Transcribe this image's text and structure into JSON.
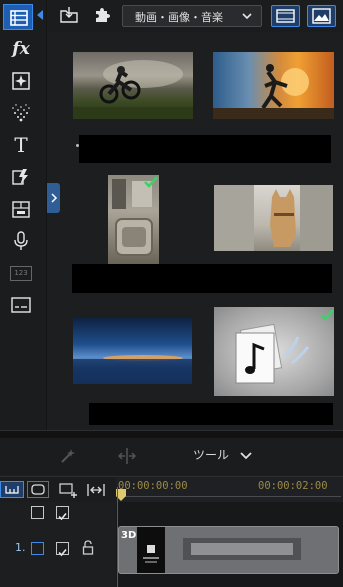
{
  "toolbar": {
    "media_filter": "動画・画像・音楽",
    "import_icon": "import-folder-icon",
    "plugin_icon": "plugin-puzzle-icon"
  },
  "rail": {
    "items": [
      {
        "name": "media-room",
        "icon": "film-strip-icon",
        "active": true
      },
      {
        "name": "effect-room",
        "icon": "fx-icon",
        "label": "fx"
      },
      {
        "name": "pip-room",
        "icon": "pip-sparkle-icon"
      },
      {
        "name": "particle-room",
        "icon": "particle-icon"
      },
      {
        "name": "title-room",
        "icon": "title-t-icon",
        "label": "T"
      },
      {
        "name": "transition-room",
        "icon": "transition-icon"
      },
      {
        "name": "chapter-room",
        "icon": "chapter-icon"
      },
      {
        "name": "voice-room",
        "icon": "microphone-icon"
      },
      {
        "name": "counter-room",
        "icon": "counter-icon",
        "label": "123"
      },
      {
        "name": "subtitle-room",
        "icon": "subtitle-icon"
      }
    ]
  },
  "media": [
    {
      "name": "motocross",
      "selected": false
    },
    {
      "name": "sunset-jumper",
      "selected": false
    },
    {
      "name": "bathroom",
      "selected": true
    },
    {
      "name": "cat",
      "selected": false
    },
    {
      "name": "blue-horizon",
      "selected": false
    },
    {
      "name": "music-file",
      "selected": true
    }
  ],
  "tools": {
    "label": "ツール"
  },
  "timeline": {
    "timecode_start": "00:00:00:00",
    "timecode_mark": "00:00:02:00",
    "track_number": "1.",
    "clip_tag": "3D"
  },
  "colors": {
    "accent": "#3f8ae6",
    "active_bg": "#1c5fb3",
    "timecode": "#9b8a46",
    "playhead": "#c03030",
    "check": "#3dd16a"
  }
}
